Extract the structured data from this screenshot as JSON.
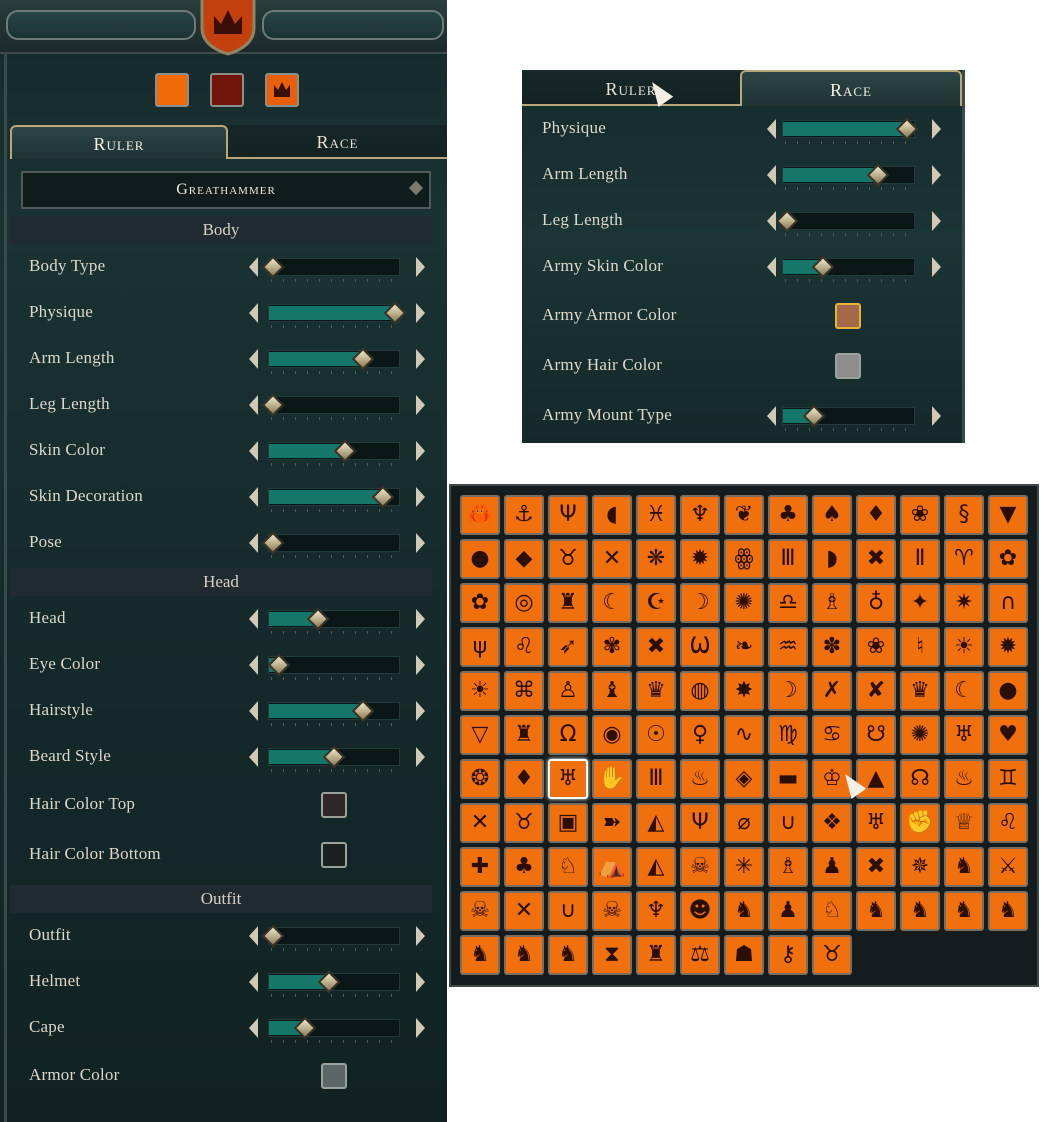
{
  "colors": {
    "accent_fill": "#15776a",
    "gold_border": "#b8a77a",
    "icon_bg": "#f0700e"
  },
  "left": {
    "colors": [
      {
        "name": "primary-color-button",
        "hex": "#f06a0a"
      },
      {
        "name": "secondary-color-button",
        "hex": "#6f150c"
      }
    ],
    "tabs": [
      {
        "label": "Ruler",
        "active": true
      },
      {
        "label": "Race",
        "active": false
      }
    ],
    "dropdown_value": "Greathammer",
    "sections": [
      {
        "title": "Body",
        "rows": [
          {
            "label": "Body Type",
            "kind": "slider",
            "value": 0.04
          },
          {
            "label": "Physique",
            "kind": "slider",
            "value": 0.96
          },
          {
            "label": "Arm Length",
            "kind": "slider",
            "value": 0.72
          },
          {
            "label": "Leg Length",
            "kind": "slider",
            "value": 0.04
          },
          {
            "label": "Skin Color",
            "kind": "slider",
            "value": 0.58
          },
          {
            "label": "Skin Decoration",
            "kind": "slider",
            "value": 0.87
          },
          {
            "label": "Pose",
            "kind": "slider",
            "value": 0.04
          }
        ]
      },
      {
        "title": "Head",
        "rows": [
          {
            "label": "Head",
            "kind": "slider",
            "value": 0.38
          },
          {
            "label": "Eye Color",
            "kind": "slider",
            "value": 0.08
          },
          {
            "label": "Hairstyle",
            "kind": "slider",
            "value": 0.72
          },
          {
            "label": "Beard Style",
            "kind": "slider",
            "value": 0.5
          },
          {
            "label": "Hair Color Top",
            "kind": "swatch",
            "color": "#2f2626"
          },
          {
            "label": "Hair Color Bottom",
            "kind": "swatch",
            "color": "#1b2121"
          }
        ]
      },
      {
        "title": "Outfit",
        "rows": [
          {
            "label": "Outfit",
            "kind": "slider",
            "value": 0.04
          },
          {
            "label": "Helmet",
            "kind": "slider",
            "value": 0.46
          },
          {
            "label": "Cape",
            "kind": "slider",
            "value": 0.28
          },
          {
            "label": "Armor Color",
            "kind": "swatch",
            "color": "#5d6666"
          }
        ]
      }
    ]
  },
  "right": {
    "tabs": [
      {
        "label": "Ruler",
        "active": false
      },
      {
        "label": "Race",
        "active": true
      }
    ],
    "rows": [
      {
        "label": "Physique",
        "kind": "slider",
        "value": 0.94
      },
      {
        "label": "Arm Length",
        "kind": "slider",
        "value": 0.72
      },
      {
        "label": "Leg Length",
        "kind": "slider",
        "value": 0.04
      },
      {
        "label": "Army Skin Color",
        "kind": "slider",
        "value": 0.31
      },
      {
        "label": "Army Armor Color",
        "kind": "swatch",
        "color": "#a66a4b"
      },
      {
        "label": "Army Hair Color",
        "kind": "swatch",
        "color": "#8d8d8d"
      },
      {
        "label": "Army Mount Type",
        "kind": "slider",
        "value": 0.24
      }
    ]
  },
  "icon_grid": {
    "selected_index": 80,
    "icons": [
      "crab-icon",
      "anchor-icon",
      "trident-icon",
      "fish-head-icon",
      "twin-fish-icon",
      "kraken-icon",
      "branch-icon",
      "tree-icon",
      "dead-tree-icon",
      "leaf-icon",
      "paw-icon",
      "salamander-icon",
      "fox-head-icon",
      "bear-icon",
      "wolf-icon",
      "bull-icon",
      "dragonfly-icon",
      "frog-icon",
      "spiked-wheel-icon",
      "eye-of-horus-icon",
      "temple-icon",
      "eagle-icon",
      "crossed-axes-icon",
      "totem-icon",
      "horned-mask-icon",
      "scarab-icon",
      "beetle-icon",
      "eye-icon",
      "tooth-icon",
      "crescent-icon",
      "moon-star-icon",
      "double-moon-icon",
      "sun-face-icon",
      "bell-icon",
      "potion-icon",
      "ring-icon",
      "four-point-star-icon",
      "eight-point-star-icon",
      "arch-icon",
      "candelabra-icon",
      "owl-icon",
      "hummingbird-icon",
      "ivy-icon",
      "crossed-bones-icon",
      "wings-icon",
      "raven-icon",
      "swan-icon",
      "flower-icon",
      "rose-icon",
      "harp-icon",
      "rising-sun-icon",
      "sun-ring-icon",
      "sunburst-icon",
      "sun-rays-icon",
      "urn-icon",
      "torch-icon",
      "flame-leaf-icon",
      "helm-icon",
      "orb-icon",
      "scythe-icon",
      "crossed-daggers-icon",
      "crossed-swords-icon",
      "crown-spikes-icon",
      "crescent-face-icon",
      "drop-icon",
      "shield-mask-icon",
      "fang-icon",
      "horseshoe-omega-icon",
      "eye-circle-icon",
      "all-seeing-eye-icon",
      "pendulum-icon",
      "lizard-icon",
      "serpent-icon",
      "coiled-snake-icon",
      "spider-icon",
      "demon-face-icon",
      "claw-icon",
      "heart-thorns-icon",
      "fire-ring-icon",
      "bat-wing-icon",
      "demon-icon",
      "hand-icon",
      "ribcage-icon",
      "flaming-sword-icon",
      "rune-diamond-icon",
      "anvil-icon",
      "crown-mountain-icon",
      "mountain-icon",
      "bow-icon",
      "flaming-torch-icon",
      "horned-helm-icon",
      "crossed-hammers-icon",
      "boar-icon",
      "tankard-icon",
      "axe-arrow-icon",
      "helmet-icon",
      "trident-fork-icon",
      "oval-ring-icon",
      "horseshoe-icon",
      "diamond-knot-icon",
      "hedgehog-icon",
      "fist-icon",
      "crown-icon",
      "lion-head-icon",
      "iron-cross-icon",
      "clover-icon",
      "horse-head-icon",
      "tent-icon",
      "spartan-helmet-icon",
      "skull-mask-icon",
      "compass-arrows-icon",
      "jester-icon",
      "crow-icon",
      "crossed-clubs-icon",
      "morning-star-icon",
      "panther-icon",
      "battle-axes-icon",
      "skull-wreath-icon",
      "rune-x-icon",
      "horns-icon",
      "skull-icon",
      "bat-icon",
      "wolf-mask-icon",
      "dragon-icon",
      "penguin-icon",
      "griffin-icon",
      "dragon-head-icon",
      "wyvern-icon",
      "winged-dragon-icon",
      "seahorse-dragon-icon",
      "rampant-lion-icon",
      "rampant-beast-icon",
      "bear-standing-icon",
      "hourglass-icon",
      "knight-helm-icon",
      "scales-icon",
      "cauldron-icon",
      "key-icon",
      "tiger-face-icon"
    ],
    "glyphs": [
      "🦀",
      "⚓",
      "Ψ",
      "◖",
      "♓",
      "♆",
      "❦",
      "♣",
      "♠",
      "♦",
      "❀",
      "§",
      "▼",
      "●",
      "◆",
      "♉",
      "✕",
      "❋",
      "✹",
      "ꙮ",
      "Ⅲ",
      "◗",
      "✖",
      "Ⅱ",
      "♈",
      "✿",
      "✿",
      "◎",
      "♜",
      "☾",
      "☪",
      "☽",
      "✺",
      "♎",
      "♗",
      "♁",
      "✦",
      "✷",
      "∩",
      "ψ",
      "♌",
      "➶",
      "✾",
      "✖",
      "Ѡ",
      "❧",
      "♒",
      "✽",
      "❀",
      "♮",
      "☀",
      "✹",
      "☀",
      "⌘",
      "♙",
      "♝",
      "♛",
      "◍",
      "✸",
      "☽",
      "✗",
      "✘",
      "♛",
      "☾",
      "●",
      "▽",
      "♜",
      "Ω",
      "◉",
      "☉",
      "♀",
      "∿",
      "♍",
      "♋",
      "☋",
      "✺",
      "♅",
      "♥",
      "❂",
      "♦",
      "♅",
      "✋",
      "Ⅲ",
      "♨",
      "◈",
      "▬",
      "♔",
      "▲",
      "☊",
      "♨",
      "♊",
      "✕",
      "♉",
      "▣",
      "➽",
      "◭",
      "Ψ",
      "⌀",
      "∪",
      "❖",
      "♅",
      "✊",
      "♕",
      "♌",
      "✚",
      "♣",
      "♘",
      "⛺",
      "◭",
      "☠",
      "✳",
      "♗",
      "♟",
      "✖",
      "✵",
      "♞",
      "⚔",
      "☠",
      "✕",
      "∪",
      "☠",
      "♆",
      "☻",
      "♞",
      "♟",
      "♘",
      "♞",
      "♞",
      "♞",
      "♞",
      "♞",
      "♞",
      "♞",
      "⧗",
      "♜",
      "⚖",
      "☗",
      "⚷",
      "♉"
    ]
  }
}
